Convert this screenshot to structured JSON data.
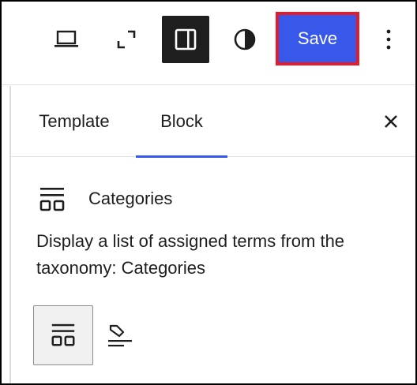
{
  "toolbar": {
    "device_icon": "laptop-icon",
    "fullscreen_icon": "fullscreen-icon",
    "sidebar_icon": "sidebar-toggle-icon",
    "styles_icon": "half-circle-styles-icon",
    "save_label": "Save",
    "more_icon": "more-vertical-icon",
    "save_color": "#3858e9",
    "highlight_color": "#e41b2a"
  },
  "tabs": [
    {
      "label": "Template",
      "active": false
    },
    {
      "label": "Block",
      "active": true
    }
  ],
  "close_icon": "close-icon",
  "block": {
    "icon": "categories-icon",
    "title": "Categories",
    "description": "Display a list of assigned terms from the taxonomy: Categories"
  },
  "variations": [
    {
      "icon": "categories-icon",
      "selected": true
    },
    {
      "icon": "tag-icon",
      "selected": false
    }
  ],
  "accent_color": "#3858e9"
}
